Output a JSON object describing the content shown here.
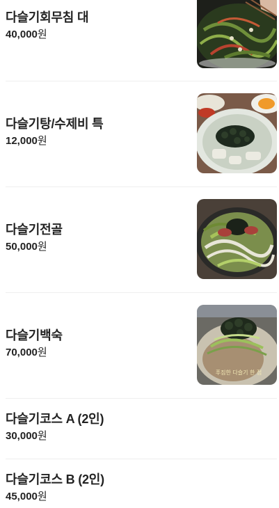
{
  "menu": {
    "items": [
      {
        "name": "다슬기회무침 대",
        "price": "40,000",
        "unit": "원",
        "has_image": true,
        "image_icon": "seasoned-raw-fish-salad-photo"
      },
      {
        "name": "다슬기탕/수제비 특",
        "price": "12,000",
        "unit": "원",
        "has_image": true,
        "image_icon": "snail-soup-sujebi-photo"
      },
      {
        "name": "다슬기전골",
        "price": "50,000",
        "unit": "원",
        "has_image": true,
        "image_icon": "hotpot-photo"
      },
      {
        "name": "다슬기백숙",
        "price": "70,000",
        "unit": "원",
        "has_image": true,
        "image_icon": "boiled-chicken-photo",
        "image_caption": "푸짐한 다슬기 한 점"
      },
      {
        "name": "다슬기코스 A (2인)",
        "price": "30,000",
        "unit": "원",
        "has_image": false
      },
      {
        "name": "다슬기코스 B (2인)",
        "price": "45,000",
        "unit": "원",
        "has_image": false
      }
    ]
  }
}
